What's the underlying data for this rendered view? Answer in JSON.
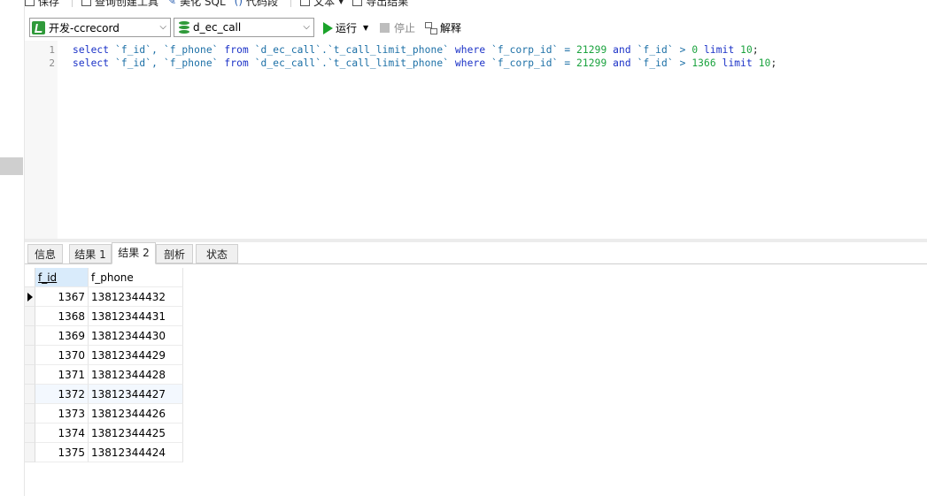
{
  "toolbar": {
    "save_label": "保存",
    "query_builder_label": "查询创建工具",
    "beautify_label": "美化 SQL",
    "snippet_label": "代码段",
    "text_label": "文本",
    "export_label": "导出结果"
  },
  "connection": {
    "selected": "开发-ccrecord"
  },
  "database": {
    "selected": "d_ec_call"
  },
  "actions": {
    "run_label": "运行",
    "stop_label": "停止",
    "explain_label": "解释"
  },
  "editor": {
    "lines": [
      {
        "number": "1",
        "select": "select",
        "cols": " `f_id`, `f_phone` ",
        "from": "from",
        "table": " `d_ec_call`.`t_call_limit_phone` ",
        "where": "where",
        "cond1": " `f_corp_id` = ",
        "val1": "21299",
        "and": " and ",
        "cond2": "`f_id` > ",
        "val2": "0",
        "limit": " limit ",
        "val3": "10",
        "end": ";"
      },
      {
        "number": "2",
        "select": "select",
        "cols": " `f_id`, `f_phone` ",
        "from": "from",
        "table": " `d_ec_call`.`t_call_limit_phone` ",
        "where": "where",
        "cond1": " `f_corp_id` = ",
        "val1": "21299",
        "and": " and ",
        "cond2": "`f_id` > ",
        "val2": "1366",
        "limit": " limit ",
        "val3": "10",
        "end": ";"
      }
    ]
  },
  "result_tabs": [
    "信息",
    "结果 1",
    "结果 2",
    "剖析",
    "状态"
  ],
  "active_tab": "结果 2",
  "grid": {
    "columns": [
      "f_id",
      "f_phone"
    ],
    "rows": [
      [
        "1367",
        "13812344432"
      ],
      [
        "1368",
        "13812344431"
      ],
      [
        "1369",
        "13812344430"
      ],
      [
        "1370",
        "13812344429"
      ],
      [
        "1371",
        "13812344428"
      ],
      [
        "1372",
        "13812344427"
      ],
      [
        "1373",
        "13812344426"
      ],
      [
        "1374",
        "13812344425"
      ],
      [
        "1375",
        "13812344424"
      ]
    ]
  },
  "colors": {
    "keyword": "#1a31c7",
    "number": "#19a23d",
    "run": "#1aa32a",
    "header_selected": "#d9ebfb"
  }
}
